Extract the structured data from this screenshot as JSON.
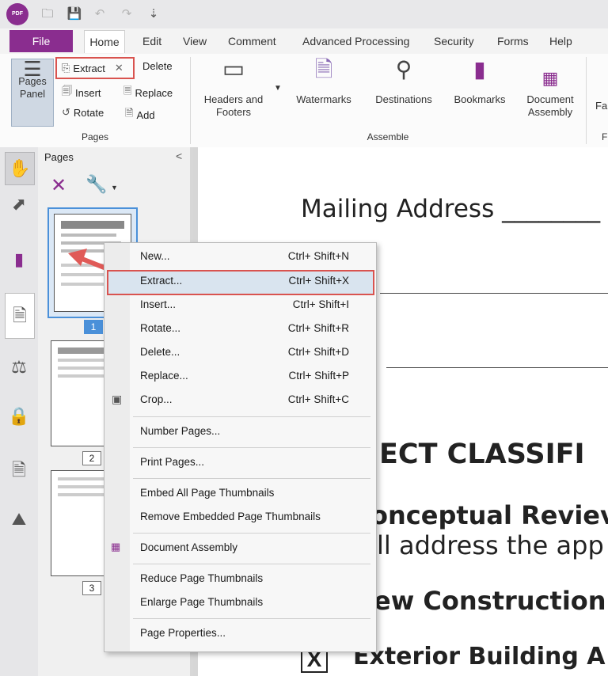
{
  "titlebar": {
    "logo": "PDF"
  },
  "quick_access": {
    "open_icon": "folder-icon",
    "save_icon": "save-icon",
    "undo_icon": "undo-icon",
    "redo_icon": "redo-icon",
    "customize_icon": "customize-icon"
  },
  "menu_tabs": [
    "File",
    "Home",
    "Edit",
    "View",
    "Comment",
    "Advanced Processing",
    "Security",
    "Forms",
    "Help"
  ],
  "active_tab": "Home",
  "ribbon": {
    "pages_panel": "Pages Panel",
    "pages_panel_l1": "Pages",
    "pages_panel_l2": "Panel",
    "extract": "Extract",
    "delete": "Delete",
    "insert": "Insert",
    "replace": "Replace",
    "rotate": "Rotate",
    "add": "Add",
    "pages_group": "Pages",
    "headers_footers_l1": "Headers and",
    "headers_footers_l2": "Footers",
    "watermarks": "Watermarks",
    "destinations": "Destinations",
    "bookmarks": "Bookmarks",
    "document_assembly_l1": "Document",
    "document_assembly_l2": "Assembly",
    "assemble_group": "Assemble",
    "cut_off_1": "Fa",
    "cut_off_2": "F"
  },
  "panel": {
    "title": "Pages",
    "collapse": "<",
    "page_numbers": [
      "1",
      "2",
      "3"
    ]
  },
  "document": {
    "mailing_address": "Mailing Address ________",
    "heading1": "JECT CLASSIFI",
    "heading2": "onceptual Reviev",
    "body1": "ll address the app",
    "heading3": "ew Construction",
    "checkbox_mark": "X",
    "heading4": "Exterior Building A"
  },
  "context_menu": [
    {
      "label": "New...",
      "shortcut": "Ctrl+ Shift+N"
    },
    {
      "label": "Extract...",
      "shortcut": "Ctrl+ Shift+X"
    },
    {
      "label": "Insert...",
      "shortcut": "Ctrl+ Shift+I"
    },
    {
      "label": "Rotate...",
      "shortcut": "Ctrl+ Shift+R"
    },
    {
      "label": "Delete...",
      "shortcut": "Ctrl+ Shift+D"
    },
    {
      "label": "Replace...",
      "shortcut": "Ctrl+ Shift+P"
    },
    {
      "label": "Crop...",
      "shortcut": "Ctrl+ Shift+C"
    },
    {
      "label": "Number Pages...",
      "shortcut": ""
    },
    {
      "label": "Print Pages...",
      "shortcut": ""
    },
    {
      "label": "Embed All Page Thumbnails",
      "shortcut": ""
    },
    {
      "label": "Remove Embedded Page Thumbnails",
      "shortcut": ""
    },
    {
      "label": "Document Assembly",
      "shortcut": ""
    },
    {
      "label": "Reduce Page Thumbnails",
      "shortcut": ""
    },
    {
      "label": "Enlarge Page Thumbnails",
      "shortcut": ""
    },
    {
      "label": "Page Properties...",
      "shortcut": ""
    }
  ],
  "colors": {
    "brand": "#8a2d8f",
    "highlight_box": "#d9534f",
    "arrow": "#e05a57"
  }
}
